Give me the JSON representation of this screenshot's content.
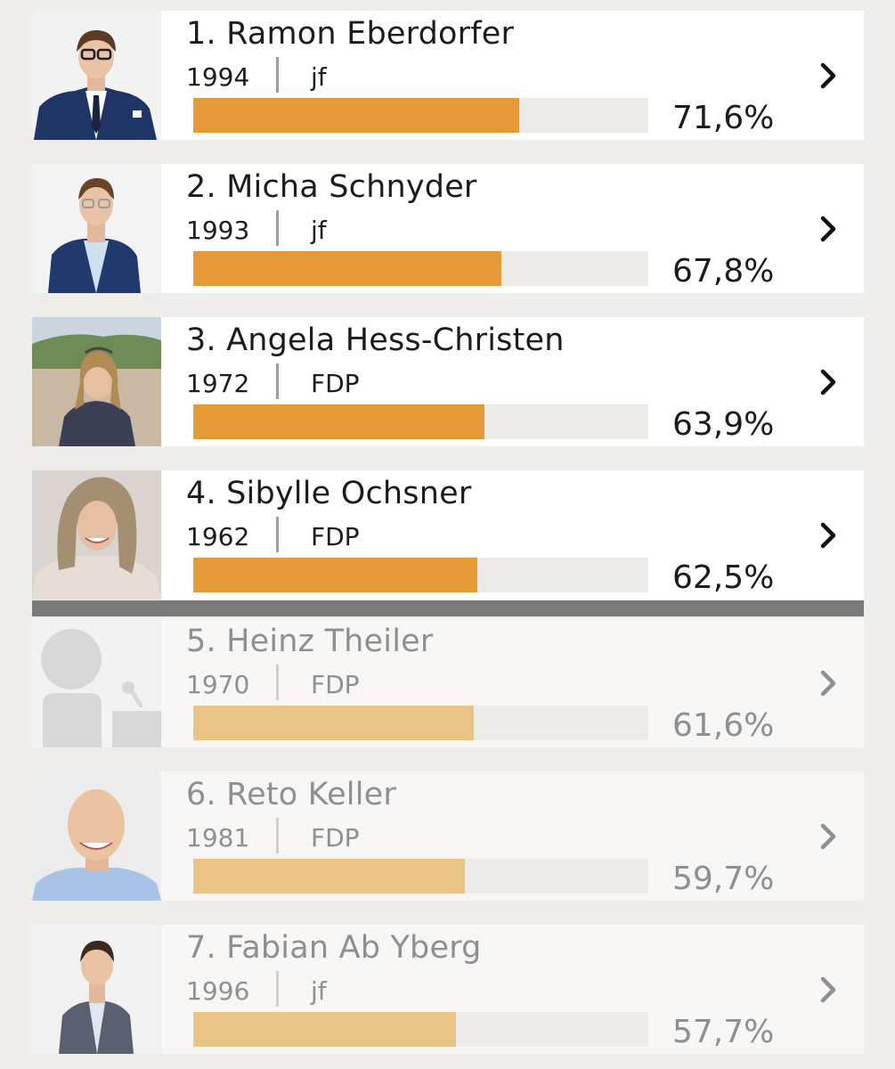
{
  "candidates": [
    {
      "rank_name": "1. Ramon Eberdorfer",
      "year": "1994",
      "party": "jf",
      "percent_label": "71,6%",
      "percent_value": 71.6,
      "elected": true
    },
    {
      "rank_name": "2. Micha Schnyder",
      "year": "1993",
      "party": "jf",
      "percent_label": "67,8%",
      "percent_value": 67.8,
      "elected": true
    },
    {
      "rank_name": "3. Angela Hess-Christen",
      "year": "1972",
      "party": "FDP",
      "percent_label": "63,9%",
      "percent_value": 63.9,
      "elected": true
    },
    {
      "rank_name": "4. Sibylle Ochsner",
      "year": "1962",
      "party": "FDP",
      "percent_label": "62,5%",
      "percent_value": 62.5,
      "elected": true
    },
    {
      "rank_name": "5. Heinz Theiler",
      "year": "1970",
      "party": "FDP",
      "percent_label": "61,6%",
      "percent_value": 61.6,
      "elected": false
    },
    {
      "rank_name": "6. Reto Keller",
      "year": "1981",
      "party": "FDP",
      "percent_label": "59,7%",
      "percent_value": 59.7,
      "elected": false
    },
    {
      "rank_name": "7. Fabian Ab Yberg",
      "year": "1996",
      "party": "jf",
      "percent_label": "57,7%",
      "percent_value": 57.7,
      "elected": false
    }
  ],
  "colors": {
    "bar_elected": "#e69a37",
    "bar_not_elected": "#e8c383",
    "bar_track": "#ebeae7",
    "divider": "#7a7a7a"
  },
  "icons": {
    "row_action": "chevron-right-icon",
    "placeholder_photo": "person-silhouette-icon"
  }
}
